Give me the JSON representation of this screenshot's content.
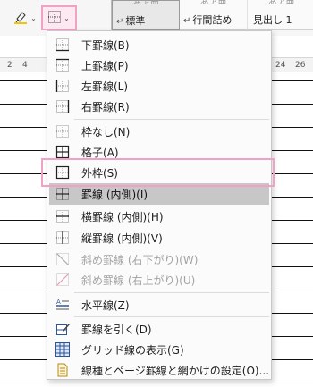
{
  "ribbon": {
    "highlight_icon": "highlighter-icon",
    "borders_icon": "borders-icon",
    "styles": [
      {
        "label": "標準",
        "mark": "↵",
        "selected": true
      },
      {
        "label": "行間詰め",
        "mark": "↵",
        "selected": false
      },
      {
        "label": "見出し 1",
        "mark": "",
        "selected": false
      }
    ]
  },
  "ruler": {
    "numbers": [
      "2",
      "4",
      "24",
      "26"
    ]
  },
  "menu": {
    "items": [
      {
        "label": "下罫線(B)",
        "icon": "bottom-border-icon",
        "enabled": true
      },
      {
        "label": "上罫線(P)",
        "icon": "top-border-icon",
        "enabled": true
      },
      {
        "label": "左罫線(L)",
        "icon": "left-border-icon",
        "enabled": true
      },
      {
        "label": "右罫線(R)",
        "icon": "right-border-icon",
        "enabled": true
      },
      {
        "label": "枠なし(N)",
        "icon": "no-border-icon",
        "enabled": true
      },
      {
        "label": "格子(A)",
        "icon": "all-borders-icon",
        "enabled": true
      },
      {
        "label": "外枠(S)",
        "icon": "outside-borders-icon",
        "enabled": true
      },
      {
        "label": "罫線 (内側)(I)",
        "icon": "inside-borders-icon",
        "enabled": true,
        "selected": true
      },
      {
        "label": "横罫線 (内側)(H)",
        "icon": "inside-horizontal-border-icon",
        "enabled": true
      },
      {
        "label": "縦罫線 (内側)(V)",
        "icon": "inside-vertical-border-icon",
        "enabled": true
      },
      {
        "label": "斜め罫線 (右下がり)(W)",
        "icon": "diagonal-down-border-icon",
        "enabled": false
      },
      {
        "label": "斜め罫線 (右上がり)(U)",
        "icon": "diagonal-up-border-icon",
        "enabled": false
      },
      {
        "label": "水平線(Z)",
        "icon": "horizontal-line-icon",
        "enabled": true
      },
      {
        "label": "罫線を引く(D)",
        "icon": "draw-table-icon",
        "enabled": true
      },
      {
        "label": "グリッド線の表示(G)",
        "icon": "view-gridlines-icon",
        "enabled": true
      },
      {
        "label": "線種とページ罫線と網かけの設定(O)...",
        "icon": "borders-and-shading-icon",
        "enabled": true
      }
    ]
  },
  "colors": {
    "highlight_pink": "#f0a2c4",
    "selected_bg": "#c7c7c7",
    "accent_blue": "#2b579a"
  }
}
